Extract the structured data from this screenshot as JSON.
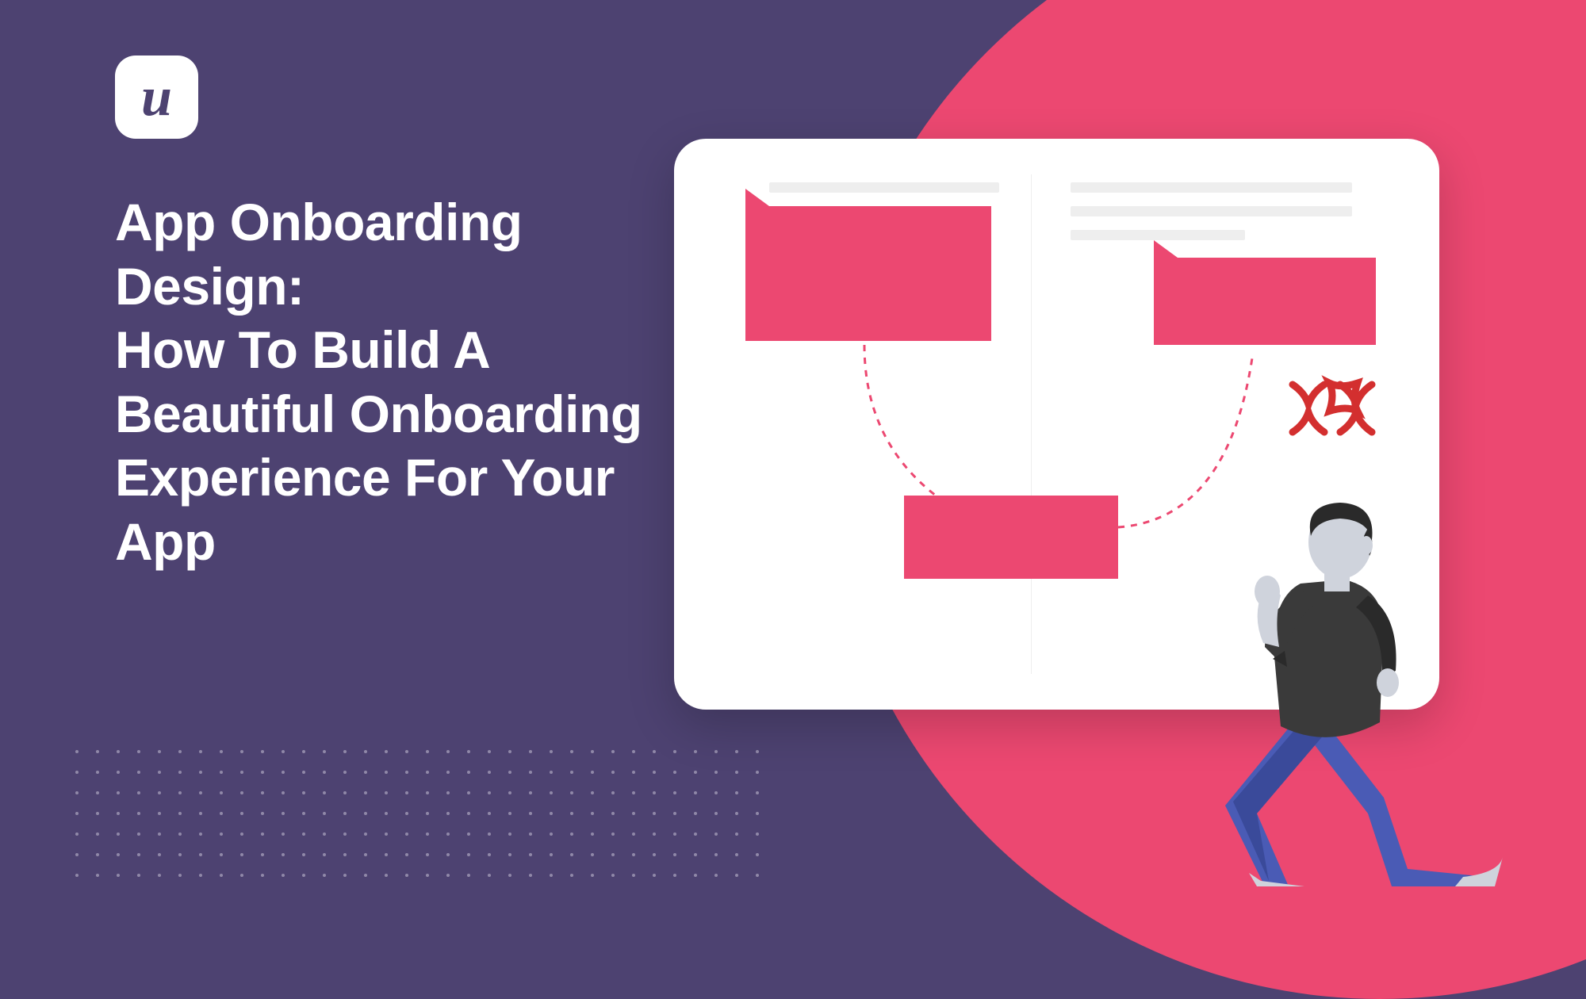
{
  "logo": {
    "letter": "u"
  },
  "headline": "App Onboarding Design:\nHow To Build A Beautiful Onboarding Experience For Your App",
  "colors": {
    "background": "#4d4271",
    "accent": "#ec4871",
    "card": "#ffffff",
    "anger": "#d32f2f"
  }
}
